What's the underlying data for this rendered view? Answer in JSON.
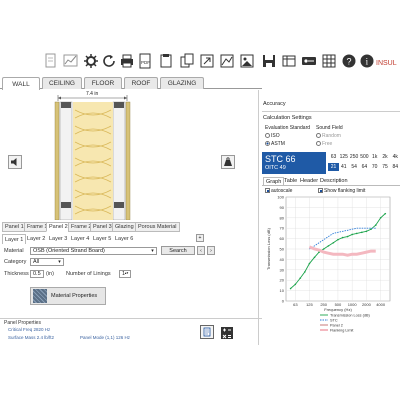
{
  "toolbar": {
    "right_label": "INSUL",
    "buttons": [
      {
        "name": "play-icon"
      },
      {
        "name": "new-file-icon"
      },
      {
        "name": "graph-icon"
      },
      {
        "name": "gear-icon"
      },
      {
        "name": "refresh-icon"
      },
      {
        "name": "print-icon"
      },
      {
        "name": "pdf-icon"
      },
      {
        "name": "clipboard-icon"
      },
      {
        "name": "copy-icon"
      },
      {
        "name": "export-icon"
      },
      {
        "name": "map-icon"
      },
      {
        "name": "image-export-icon"
      },
      {
        "name": "save-icon"
      },
      {
        "name": "sheet-icon"
      },
      {
        "name": "key-icon"
      },
      {
        "name": "grid-icon"
      },
      {
        "name": "help-icon"
      },
      {
        "name": "info-icon"
      }
    ]
  },
  "tabs": [
    "WALL",
    "CEILING",
    "FLOOR",
    "ROOF",
    "GLAZING"
  ],
  "active_tab": "WALL",
  "wall": {
    "dimension": "7.4 in"
  },
  "panel_tabs": [
    "Panel 1",
    "Frame 1",
    "Panel 2",
    "Frame 2",
    "Panel 3",
    "Glazing",
    "Porous Material"
  ],
  "active_panel_tab": "Panel 2",
  "layer_tabs": [
    "Layer 1",
    "Layer 2",
    "Layer 3",
    "Layer 4",
    "Layer 5",
    "Layer 6"
  ],
  "active_layer_tab": "Layer 1",
  "form": {
    "material_label": "Material",
    "material_value": "OSB (Oriented Strand Board)",
    "search_label": "Search",
    "category_label": "Category",
    "category_value": "All",
    "thickness_label": "Thickness",
    "thickness_value": "0.5",
    "thickness_unit": "(in)",
    "linings_label": "Number of Linings",
    "linings_value": "1",
    "material_props_label": "Material Properties"
  },
  "panel_props": {
    "title": "Panel Properties",
    "line1": "Critical Freq 2820 Hz",
    "line2a": "Surface Mass 2.4 lb/ft2",
    "line2b": "Panel Mode (1,1) 126 Hz"
  },
  "right": {
    "accuracy_label": "Accuracy",
    "calc_settings_label": "Calculation Settings",
    "eval_label": "Evaluation Standard",
    "sound_field_label": "Sound Field",
    "iso_label": "ISO",
    "astm_label": "ASTM",
    "random_label": "Random",
    "free_label": "Free",
    "stc_label": "STC 66",
    "oitc_label": "OITC 49",
    "freq_headers": [
      "63",
      "125",
      "250",
      "500",
      "1k",
      "2k",
      "4k"
    ],
    "freq_values": [
      "21",
      "41",
      "54",
      "64",
      "70",
      "75",
      "84"
    ],
    "graph_tabs": [
      "Graph",
      "Table",
      "Header",
      "Description"
    ],
    "active_graph_tab": "Graph",
    "autoscale_label": "autoscale",
    "flanking_label": "Show flanking limit"
  },
  "chart_data": {
    "type": "line",
    "xlabel": "Frequency (Hz)",
    "ylabel": "Transmission Loss (dB)",
    "ylim": [
      0,
      100
    ],
    "yticks": [
      0,
      10,
      20,
      30,
      40,
      50,
      60,
      70,
      80,
      90,
      100
    ],
    "xticks": [
      "63",
      "125",
      "250",
      "500",
      "1000",
      "2000",
      "4000"
    ],
    "x": [
      50,
      63,
      80,
      100,
      125,
      160,
      200,
      250,
      315,
      400,
      500,
      630,
      800,
      1000,
      1250,
      1600,
      2000,
      2500,
      3150,
      4000,
      5000
    ],
    "series": [
      {
        "name": "Transmission Loss (dB)",
        "color": "#1aa34a",
        "values": [
          12,
          16,
          22,
          28,
          36,
          42,
          47,
          50,
          53,
          56,
          59,
          61,
          62,
          64,
          65,
          66,
          67,
          69,
          73,
          80,
          84
        ]
      },
      {
        "name": "STC",
        "color": "#2b7bd8",
        "style": "dashed",
        "values": [
          null,
          null,
          null,
          null,
          50,
          53,
          56,
          59,
          62,
          65,
          66,
          67,
          68,
          69,
          70,
          70,
          70,
          70,
          70,
          null,
          null
        ]
      },
      {
        "name": "Panel 2",
        "color": "#c26a6a",
        "values": [
          null,
          null,
          null,
          null,
          null,
          null,
          null,
          null,
          null,
          null,
          null,
          null,
          null,
          null,
          null,
          null,
          null,
          null,
          null,
          null,
          null
        ]
      },
      {
        "name": "Flanking Limit",
        "color": "#f4b8c0",
        "values": [
          null,
          null,
          null,
          null,
          52,
          50,
          49,
          47,
          46,
          45,
          45,
          45,
          44,
          45,
          45,
          46,
          47,
          48,
          48,
          null,
          null
        ]
      }
    ],
    "legend_position": "bottom",
    "grid": true
  }
}
